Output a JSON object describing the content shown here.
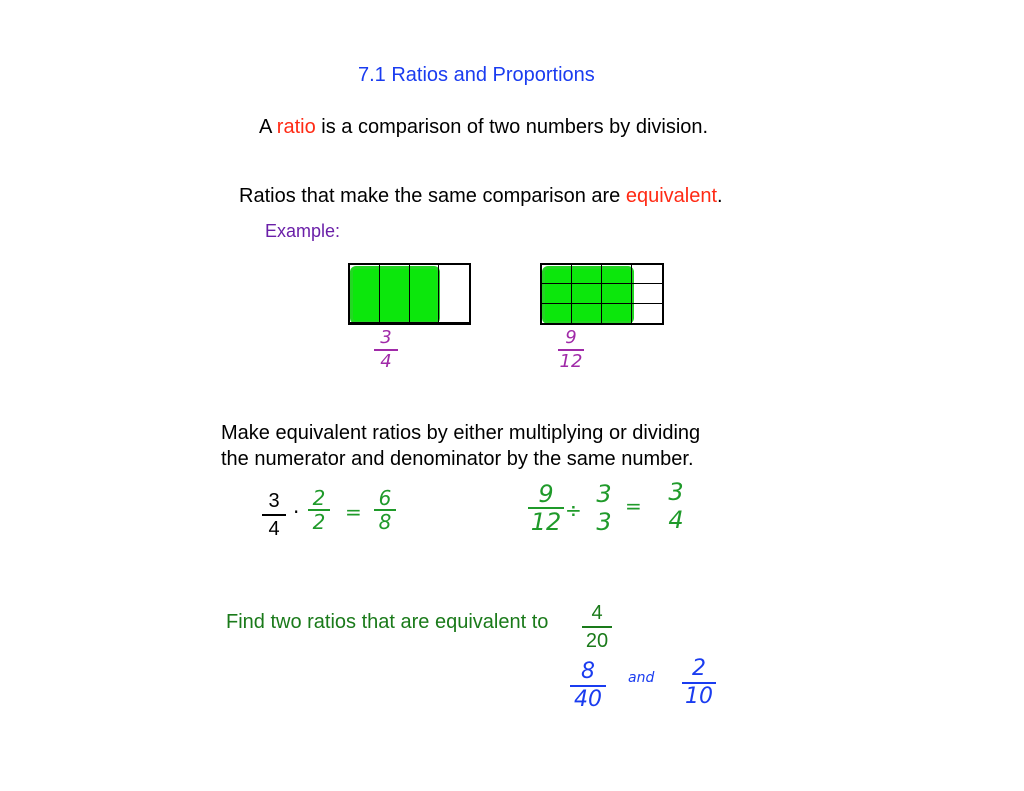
{
  "title": "7.1  Ratios and Proportions",
  "definition": {
    "prefix": "A ",
    "term": "ratio",
    "suffix": " is a comparison of two numbers by division."
  },
  "equivalence": {
    "prefix": "Ratios that make the same comparison are ",
    "term": "equivalent",
    "suffix": "."
  },
  "example_label": "Example:",
  "example_models": [
    {
      "rows": 1,
      "cols": 4,
      "shaded_cols": 3,
      "label": {
        "numerator": "3",
        "denominator": "4"
      }
    },
    {
      "rows": 3,
      "cols": 4,
      "shaded_cols": 3,
      "label": {
        "numerator": "9",
        "denominator": "12"
      }
    }
  ],
  "method": {
    "line1": "Make equivalent ratios by either multiplying or dividing",
    "line2": "the numerator and denominator by the same number."
  },
  "multiply_example": {
    "start": {
      "numerator": "3",
      "denominator": "4"
    },
    "operator": "·",
    "factor": {
      "numerator": "2",
      "denominator": "2"
    },
    "equals": "=",
    "result": {
      "numerator": "6",
      "denominator": "8"
    }
  },
  "divide_example": {
    "start": {
      "numerator": "9",
      "denominator": "12"
    },
    "operator": "÷",
    "factor": {
      "numerator": "3",
      "denominator": "3"
    },
    "equals": "=",
    "result": {
      "numerator": "3",
      "denominator": "4"
    }
  },
  "exercise": {
    "prompt": "Find two ratios that are equivalent to",
    "target": {
      "numerator": "4",
      "denominator": "20"
    },
    "answer1": {
      "numerator": "8",
      "denominator": "40"
    },
    "connector": "and",
    "answer2": {
      "numerator": "2",
      "denominator": "10"
    }
  },
  "colors": {
    "title": "#1a3cf0",
    "keyword": "#ff2a14",
    "example": "#6a1fa8",
    "handwriting_purple": "#a02aa8",
    "handwriting_green": "#1f9a2a",
    "handwriting_blue": "#1a3cf0",
    "shading": "#00e600",
    "exercise": "#1a7a1a"
  }
}
